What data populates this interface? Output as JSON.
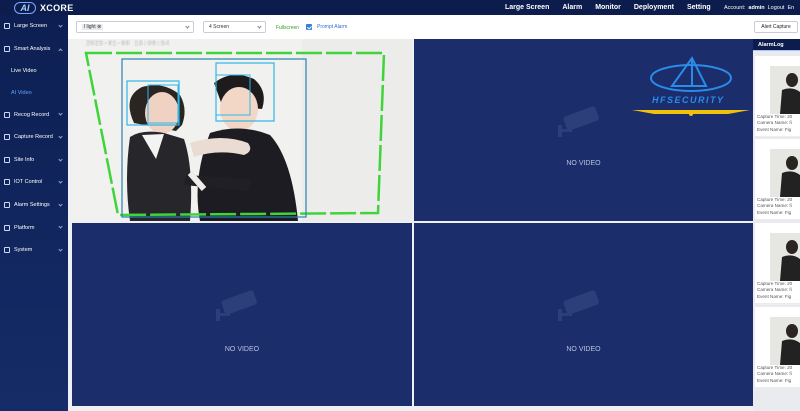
{
  "app": {
    "logo_badge": "AI",
    "logo_text": "XCORE"
  },
  "topnav": {
    "items": [
      "Large Screen",
      "Alarm",
      "Monitor",
      "Deployment",
      "Setting"
    ]
  },
  "account": {
    "label": "Account:",
    "user": "admin",
    "logout": "Logout",
    "lang": "En"
  },
  "sidebar": {
    "items": [
      {
        "label": "Large Screen"
      },
      {
        "label": "Smart Analysis"
      },
      {
        "label": "Recog Record"
      },
      {
        "label": "Capture Record"
      },
      {
        "label": "Site Info"
      },
      {
        "label": "IOT Control"
      },
      {
        "label": "Alarm Settings"
      },
      {
        "label": "Platform"
      },
      {
        "label": "System"
      }
    ],
    "sub_items": [
      {
        "label": "Live Video",
        "active": false
      },
      {
        "label": "AI Video",
        "active": true
      }
    ]
  },
  "toolbar": {
    "camera_chip": "l light",
    "screen_select": "4 Screen",
    "fullscreen_label": "Fullscreen",
    "prompt_alarm_label": "Prompt Alarm",
    "prompt_alarm_checked": true,
    "alert_capture_label": "Alert Capture"
  },
  "video_grid": {
    "cell_1": {
      "timestamp": "2025-01-09 16:09:54"
    },
    "cell_2": {
      "status": "NO VIDEO"
    },
    "cell_3": {
      "status": "NO VIDEO"
    },
    "cell_4": {
      "status": "NO VIDEO"
    }
  },
  "alarm_log": {
    "title": "AlarmLog",
    "cards": [
      {
        "line1": "Capture Time: 20",
        "line2": "Camera Name: fi",
        "line3": "Event Name: Fig"
      },
      {
        "line1": "Capture Time: 20",
        "line2": "Camera Name: fi",
        "line3": "Event Name: Fig"
      },
      {
        "line1": "Capture Time: 20",
        "line2": "Camera Name: fi",
        "line3": "Event Name: Fig"
      },
      {
        "line1": "Capture Time: 20",
        "line2": "Camera Name: fi",
        "line3": "Event Name: Fig"
      }
    ]
  },
  "watermark": {
    "text": "HFSECURITY"
  },
  "colors": {
    "nav_bg": "#0c1d4d",
    "cell_bg": "#1b2d6b",
    "detect_green": "#3fd43a",
    "detect_cyan": "#2fb6e6",
    "active_blue": "#58a7ff"
  },
  "icons": [
    "shield-icon",
    "checkbox-icon",
    "camera-icon",
    "chevron-down-icon"
  ]
}
